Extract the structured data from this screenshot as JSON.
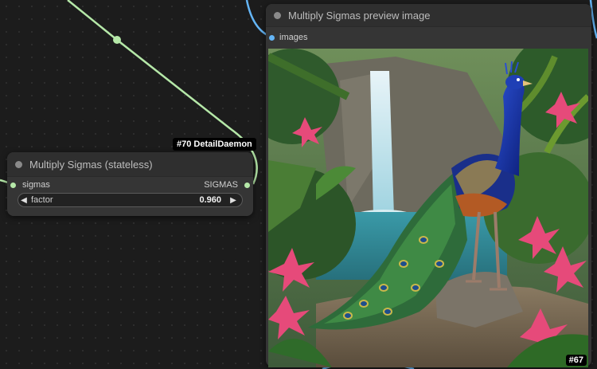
{
  "nodes": {
    "multiply_sigmas": {
      "title": "Multiply Sigmas (stateless)",
      "input_label": "sigmas",
      "output_label": "SIGMAS",
      "widget": {
        "label": "factor",
        "value": "0.960"
      }
    },
    "preview": {
      "title": "Multiply Sigmas preview image",
      "input_label": "images",
      "id_badge": "#67"
    }
  },
  "detail_daemon_badge": "#70 DetailDaemon",
  "colors": {
    "sigma_wire": "#b5e8a8",
    "image_wire": "#64b5f6",
    "node_bg": "#353535",
    "canvas_bg": "#1c1c1c"
  },
  "icons": {
    "decrement": "left-arrow",
    "increment": "right-arrow"
  }
}
